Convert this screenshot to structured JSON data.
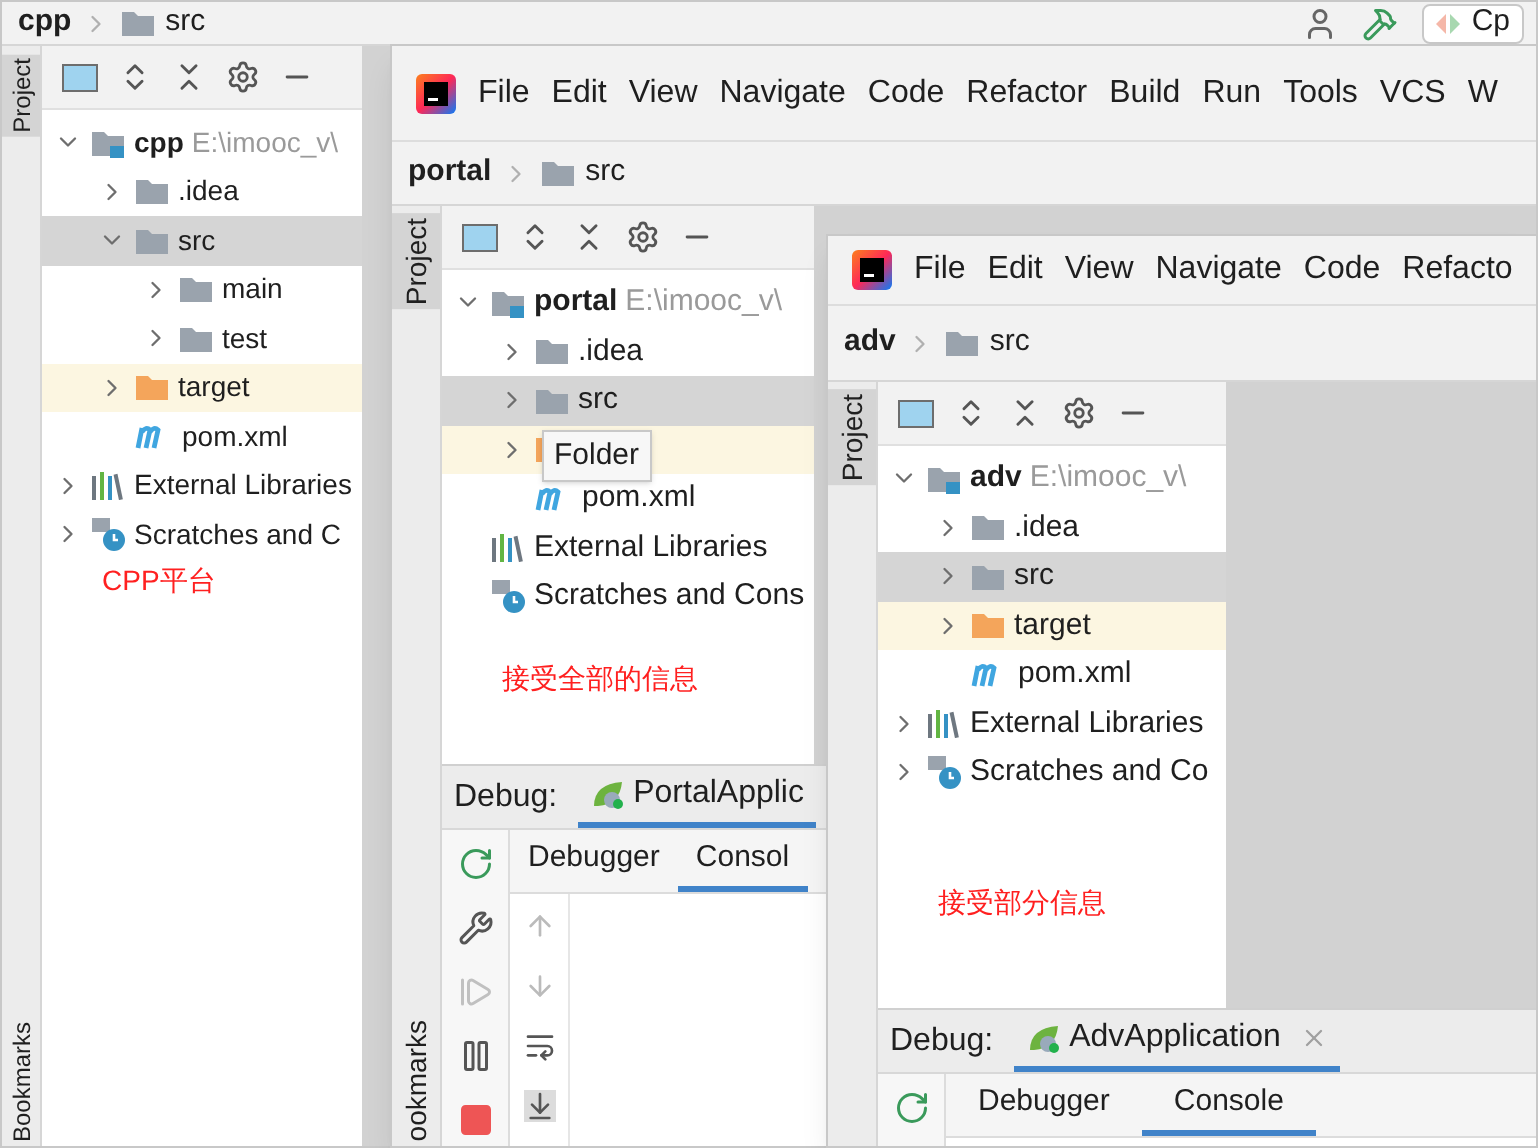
{
  "windows": [
    {
      "breadcrumb": [
        "cpp",
        "src"
      ],
      "run_config": "Cp",
      "side_tabs": [
        "Project",
        "Bookmarks"
      ],
      "tree": [
        {
          "kind": "module",
          "name": "cpp",
          "path": "E:\\imooc_v\\",
          "expanded": true,
          "selected": false,
          "children": [
            {
              "kind": "folder",
              "name": ".idea",
              "expanded": false,
              "selected": false
            },
            {
              "kind": "folder",
              "name": "src",
              "expanded": true,
              "selected": true,
              "children": [
                {
                  "kind": "folder",
                  "name": "main",
                  "expanded": false,
                  "selected": false
                },
                {
                  "kind": "folder",
                  "name": "test",
                  "expanded": false,
                  "selected": false
                }
              ]
            },
            {
              "kind": "excluded_folder",
              "name": "target",
              "expanded": false,
              "selected": false
            },
            {
              "kind": "maven",
              "name": "pom.xml",
              "selected": false
            }
          ]
        },
        {
          "kind": "libraries",
          "name": "External Libraries",
          "expanded": false,
          "selected": false
        },
        {
          "kind": "scratches",
          "name": "Scratches and C",
          "expanded": false,
          "selected": false
        }
      ],
      "note": "CPP平台"
    },
    {
      "menu": [
        "File",
        "Edit",
        "View",
        "Navigate",
        "Code",
        "Refactor",
        "Build",
        "Run",
        "Tools",
        "VCS",
        "W"
      ],
      "breadcrumb": [
        "portal",
        "src"
      ],
      "side_tabs": [
        "Project",
        "ookmarks"
      ],
      "tree": [
        {
          "kind": "module",
          "name": "portal",
          "path": "E:\\imooc_v\\",
          "expanded": true,
          "selected": false,
          "children": [
            {
              "kind": "folder",
              "name": ".idea",
              "expanded": false,
              "selected": false
            },
            {
              "kind": "folder",
              "name": "src",
              "expanded": false,
              "selected": true
            },
            {
              "kind": "excluded_folder",
              "tooltip": "Folder",
              "expanded": false,
              "selected": false
            },
            {
              "kind": "maven",
              "name": "pom.xml",
              "selected": false
            }
          ]
        },
        {
          "kind": "libraries",
          "name": "External Libraries",
          "selected": false
        },
        {
          "kind": "scratches",
          "name": "Scratches and Cons",
          "selected": false
        }
      ],
      "note": "接受全部的信息",
      "debug": {
        "label": "Debug:",
        "session": "PortalApplic",
        "tabs": [
          {
            "label": "Debugger",
            "selected": false
          },
          {
            "label": "Consol",
            "selected": true
          }
        ]
      }
    },
    {
      "menu": [
        "File",
        "Edit",
        "View",
        "Navigate",
        "Code",
        "Refacto"
      ],
      "breadcrumb": [
        "adv",
        "src"
      ],
      "side_tabs": [
        "Project"
      ],
      "tree": [
        {
          "kind": "module",
          "name": "adv",
          "path": "E:\\imooc_v\\",
          "expanded": true,
          "selected": false,
          "children": [
            {
              "kind": "folder",
              "name": ".idea",
              "expanded": false,
              "selected": false
            },
            {
              "kind": "folder",
              "name": "src",
              "expanded": false,
              "selected": true
            },
            {
              "kind": "excluded_folder",
              "name": "target",
              "expanded": false,
              "selected": false
            },
            {
              "kind": "maven",
              "name": "pom.xml",
              "selected": false
            }
          ]
        },
        {
          "kind": "libraries",
          "name": "External Libraries",
          "expanded": false,
          "selected": false
        },
        {
          "kind": "scratches",
          "name": "Scratches and Co",
          "expanded": false,
          "selected": false
        }
      ],
      "note": "接受部分信息",
      "debug": {
        "label": "Debug:",
        "session": "AdvApplication",
        "closable": true,
        "tabs": [
          {
            "label": "Debugger",
            "selected": false
          },
          {
            "label": "Console",
            "selected": true
          }
        ]
      }
    }
  ]
}
